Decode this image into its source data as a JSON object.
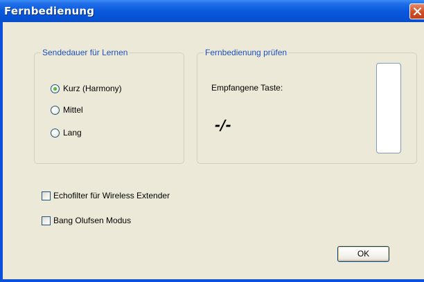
{
  "window": {
    "title": "Fernbedienung"
  },
  "group_send": {
    "title": "Sendedauer für Lernen",
    "options": [
      {
        "label": "Kurz (Harmony)",
        "selected": true
      },
      {
        "label": "Mittel",
        "selected": false
      },
      {
        "label": "Lang",
        "selected": false
      }
    ]
  },
  "group_test": {
    "title": "Fernbedienung prüfen",
    "received_label": "Empfangene Taste:",
    "received_value": "-/-"
  },
  "checkboxes": [
    {
      "label": "Echofilter für Wireless Extender",
      "checked": false
    },
    {
      "label": "Bang Olufsen Modus",
      "checked": false
    }
  ],
  "buttons": {
    "ok": "OK"
  },
  "colors": {
    "titlebar": "#0753d6",
    "group_title": "#1c4fbe",
    "dialog_bg": "#ece9d8"
  },
  "icons": {
    "close": "close-icon"
  }
}
